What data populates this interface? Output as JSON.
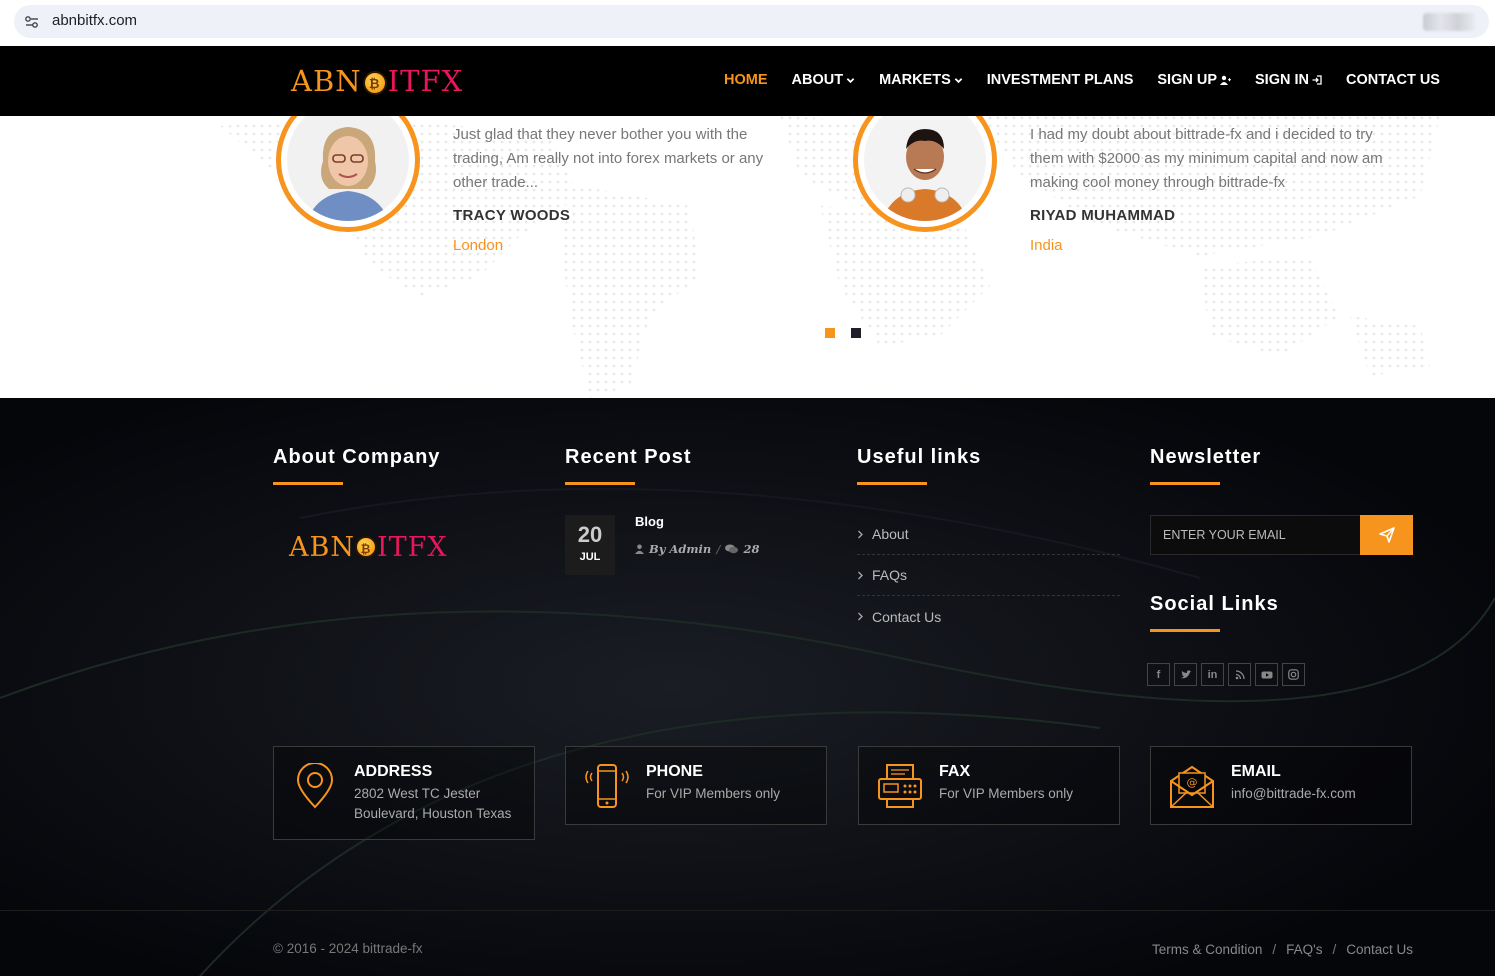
{
  "browser": {
    "url": "abnbitfx.com"
  },
  "header": {
    "logo_left": "ABN",
    "logo_coin": "₿",
    "logo_right": "ITFX",
    "nav": [
      {
        "label": "HOME",
        "active": true
      },
      {
        "label": "ABOUT"
      },
      {
        "label": "MARKETS"
      },
      {
        "label": "INVESTMENT PLANS"
      },
      {
        "label": "SIGN UP"
      },
      {
        "label": "SIGN IN"
      },
      {
        "label": "CONTACT US"
      }
    ]
  },
  "testimonials": [
    {
      "text": "Just glad that they never bother you with the trading, Am really not into forex markets or any other trade...",
      "name": "TRACY WOODS",
      "location": "London"
    },
    {
      "text": "I had my doubt about bittrade-fx and i decided to try them with $2000 as my minimum capital and now am making cool money through bittrade-fx",
      "name": "RIYAD MUHAMMAD",
      "location": "India"
    }
  ],
  "carousel": {
    "active_index": 0,
    "count": 2
  },
  "footer": {
    "about_title": "About Company",
    "recent_title": "Recent Post",
    "links_title": "Useful links",
    "newsletter_title": "Newsletter",
    "social_title": "Social Links",
    "post": {
      "day": "20",
      "month": "JUL",
      "title": "Blog",
      "author": "By Admin",
      "comments": "28"
    },
    "links": [
      "About",
      "FAQs",
      "Contact Us"
    ],
    "newsletter_placeholder": "ENTER YOUR EMAIL",
    "contacts": [
      {
        "title": "ADDRESS",
        "text": "2802 West TC Jester Boulevard, Houston Texas"
      },
      {
        "title": "PHONE",
        "text": "For VIP Members only"
      },
      {
        "title": "FAX",
        "text": "For VIP Members only"
      },
      {
        "title": "EMAIL",
        "text": "info@bittrade-fx.com"
      }
    ],
    "copyright": "© 2016 - 2024 bittrade-fx",
    "bottom_links": [
      "Terms & Condition",
      "FAQ's",
      "Contact Us"
    ]
  },
  "colors": {
    "accent": "#f7941d",
    "logo_pink": "#e8165a",
    "dark": "#05060a"
  }
}
